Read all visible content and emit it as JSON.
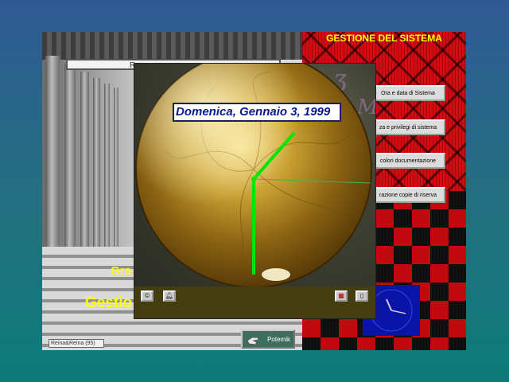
{
  "left_panel": {
    "title_fragment": "R",
    "label_gra": "Gra",
    "label_gestio": "Gestio",
    "status_text": "Reina&Reina (95)",
    "potpourri_button": "Potemik"
  },
  "system_panel": {
    "title": "GESTIONE DEL SISTEMA",
    "buttons": [
      {
        "label": "Ora e data di Sistema"
      },
      {
        "label": "za e privilegi di sistema"
      },
      {
        "label": "colori documentazione"
      },
      {
        "label": "razione copie di riserva"
      }
    ]
  },
  "clock_window": {
    "date_value": "Domenica, Gennaio 3, 1999",
    "toolbar_left": [
      "C",
      "bell"
    ],
    "toolbar_right": [
      "calendar",
      "exit"
    ]
  },
  "colors": {
    "accent_yellow": "#ffff00",
    "clock_hands": "#00e600",
    "date_text": "#0a1a8c",
    "panel_red": "#d50b12",
    "analog_clock_bg": "#0a14a8"
  }
}
